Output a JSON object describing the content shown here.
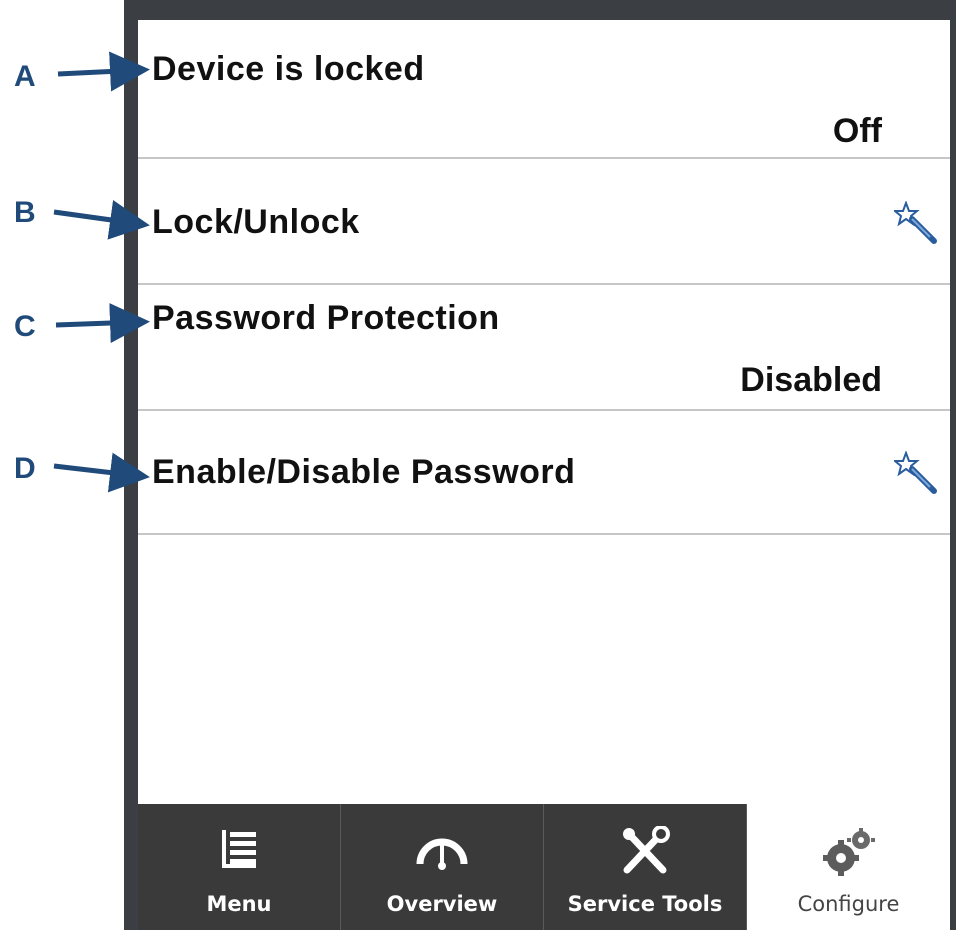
{
  "callouts": [
    "A",
    "B",
    "C",
    "D"
  ],
  "settings": {
    "device_locked": {
      "title": "Device is locked",
      "value": "Off"
    },
    "lock_unlock": {
      "title": "Lock/Unlock",
      "icon": "wizard-wand-icon"
    },
    "password_protection": {
      "title": "Password Protection",
      "value": "Disabled"
    },
    "enable_disable_password": {
      "title": "Enable/Disable Password",
      "icon": "wizard-wand-icon"
    }
  },
  "tabs": [
    {
      "label": "Menu",
      "icon": "menu-list-icon",
      "active": false
    },
    {
      "label": "Overview",
      "icon": "gauge-icon",
      "active": false
    },
    {
      "label": "Service Tools",
      "icon": "tools-icon",
      "active": false
    },
    {
      "label": "Configure",
      "icon": "gears-icon",
      "active": true
    }
  ],
  "colors": {
    "callout": "#1f4a7a",
    "frame": "#3b3f44",
    "tab_bg": "#3a3a3a",
    "divider": "#c6c6c6"
  }
}
